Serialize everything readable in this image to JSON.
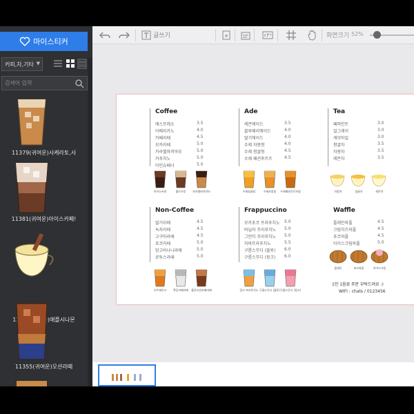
{
  "sidebar": {
    "my_sticker_label": "마이스티커",
    "category": "커피,차,기타",
    "search_placeholder": "검색어 입력",
    "items": [
      {
        "label": "11379(귀여운)사케라토,사"
      },
      {
        "label": "11381(귀여운)아이스카페!"
      },
      {
        "label": "11363(귀여운)애플시나몬"
      },
      {
        "label": "11355(귀여운)오션라떼"
      }
    ]
  },
  "toolbar": {
    "text_label": "글쓰기",
    "zoom_label": "화면크기",
    "zoom_value": "52%",
    "zoom_fraction": 0.15
  },
  "menu": {
    "sections": [
      {
        "title": "Coffee",
        "items": [
          {
            "name": "에스프레소",
            "price": "3.5"
          },
          {
            "name": "아메리카노",
            "price": "4.0"
          },
          {
            "name": "카페라떼",
            "price": "4.5"
          },
          {
            "name": "모카라떼",
            "price": "5.0"
          },
          {
            "name": "카라멜마끼아또",
            "price": "5.0"
          },
          {
            "name": "카푸치노",
            "price": "5.0"
          },
          {
            "name": "아인슈페너",
            "price": "5.0"
          }
        ],
        "captions": [
          "아이스커피",
          "콜드브루",
          "카라멜마끼아또"
        ]
      },
      {
        "title": "Ade",
        "items": [
          {
            "name": "레몬에이드",
            "price": "3.5"
          },
          {
            "name": "블루베리에이드",
            "price": "4.0"
          },
          {
            "name": "딸기에이드",
            "price": "4.0"
          },
          {
            "name": "수제 자몽청",
            "price": "4.0"
          },
          {
            "name": "수제 청귤청",
            "price": "4.5"
          },
          {
            "name": "수제 패션후르츠",
            "price": "4.5"
          }
        ],
        "captions": [
          "수제청귤청",
          "수제자몽청",
          "수제패션후르츠청"
        ]
      },
      {
        "title": "Tea",
        "items": [
          {
            "name": "페퍼민트",
            "price": "3.0"
          },
          {
            "name": "얼그레이",
            "price": "3.0"
          },
          {
            "name": "캐모마일",
            "price": "3.0"
          },
          {
            "name": "청귤차",
            "price": "3.5"
          },
          {
            "name": "자몽차",
            "price": "3.5"
          },
          {
            "name": "레몬차",
            "price": "3.5"
          }
        ],
        "captions": [
          "자몽차",
          "청귤차",
          "레몬차"
        ]
      },
      {
        "title": "Non-Coffee",
        "items": [
          {
            "name": "딸기라떼",
            "price": "4.5"
          },
          {
            "name": "녹차라떼",
            "price": "4.5"
          },
          {
            "name": "고구마라떼",
            "price": "4.5"
          },
          {
            "name": "초코라떼",
            "price": "5.0"
          },
          {
            "name": "망고바나나라떼",
            "price": "5.0"
          },
          {
            "name": "로투스라떼",
            "price": "5.0"
          }
        ],
        "captions": [
          "오트쉐이크",
          "흑당카페라떼",
          "블루오션카페라떼"
        ]
      },
      {
        "title": "Frappuccino",
        "items": [
          {
            "name": "모카초코 프라푸치노",
            "price": "5.0"
          },
          {
            "name": "바닐라 프라푸치노",
            "price": "5.0"
          },
          {
            "name": "그린티 프라푸치노",
            "price": "5.0"
          },
          {
            "name": "자바프라푸치노",
            "price": "5.5"
          },
          {
            "name": "구름스무디 (블루)",
            "price": "6.0"
          },
          {
            "name": "구름스무디 (핑크)",
            "price": "6.0"
          }
        ],
        "captions": [
          "망고 프라푸치노",
          "구름스무디 (블루)",
          "구름스무디 (핑크)"
        ]
      },
      {
        "title": "Waffle",
        "items": [
          {
            "name": "플레인와플",
            "price": "4.5"
          },
          {
            "name": "크림치즈와플",
            "price": "4.5"
          },
          {
            "name": "초코와플",
            "price": "4.5"
          },
          {
            "name": "아이스크림와플",
            "price": "5.0"
          }
        ],
        "captions": [
          "플레인",
          "초코와플",
          "아이스크림"
        ]
      }
    ],
    "footer_line1": "1인 1음료 주문 부탁드려요 :)",
    "footer_line2": "WIFI : chats / 0123456"
  },
  "colors": {
    "accent": "#2e7de9",
    "sidebar_bg": "#2f3033",
    "editor_bg": "#e9e9ec"
  }
}
